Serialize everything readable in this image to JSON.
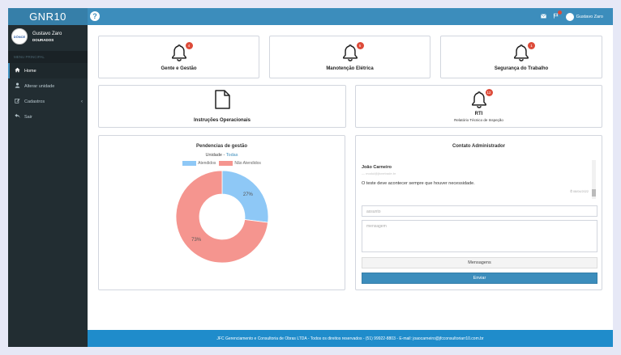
{
  "app": {
    "brand": "GNR10"
  },
  "user": {
    "name": "Gustavo Zaro",
    "unit": "DOURADOS",
    "avatar_text": "DÔNCE"
  },
  "sidebar": {
    "header": "MENU PRINCIPAL",
    "items": [
      {
        "label": "Home",
        "icon": "home-icon"
      },
      {
        "label": "Alterar unidade",
        "icon": "user-icon"
      },
      {
        "label": "Cadastros",
        "icon": "edit-icon"
      },
      {
        "label": "Sair",
        "icon": "back-arrow-icon"
      }
    ]
  },
  "topbar": {
    "user_name": "Gustavo Zaro"
  },
  "cards": [
    {
      "title": "Gente e Gestão",
      "badge": "4"
    },
    {
      "title": "Manotenção Elétrica",
      "badge": "5"
    },
    {
      "title": "Segurança do Trabalho",
      "badge": "1"
    },
    {
      "title": "Instruções Operacionais"
    },
    {
      "title": "RTI",
      "subtitle": "Relatório Técnico de Inspeção",
      "badge": "12"
    }
  ],
  "pending": {
    "title": "Pendencias de gestão",
    "unit_label": "Unidade -",
    "unit_link": "Todas"
  },
  "chart_data": {
    "type": "pie",
    "categories": [
      "Atendidos",
      "Não Atendidos"
    ],
    "values": [
      27,
      73
    ],
    "labels": [
      "27%",
      "73%"
    ],
    "colors": [
      "#8ec8f6",
      "#f5958f"
    ],
    "legend": "top"
  },
  "contact": {
    "title": "Contato Administrador",
    "message": {
      "name": "João Carneiro",
      "email": "— modul@jfcnetrade.br",
      "text": "O teste deve acontecer sempre que houver necessidade.",
      "date": "⏱ 08/04/2022"
    },
    "subject_placeholder": "assunto",
    "message_placeholder": "mensagem",
    "messages_button": "Mensagens",
    "send_button": "Enviar"
  },
  "footer": {
    "text": "JFC Gerenciamento e Consultoria de Obras LTDA - Todos os direitos reservados - (51) 99922-8803 - E-mail: joaocarneiro@jfcconsultoriarr10.com.br"
  }
}
